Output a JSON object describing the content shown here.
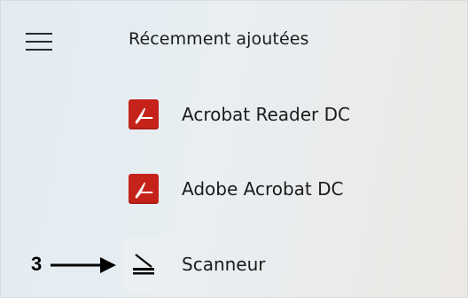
{
  "start_menu": {
    "menu_button_icon": "hamburger-icon",
    "section_title": "Récemment ajoutées",
    "apps": [
      {
        "label": "Acrobat Reader DC",
        "icon": "acrobat-pdf-icon",
        "icon_color": "#c5221a"
      },
      {
        "label": "Adobe Acrobat DC",
        "icon": "acrobat-pdf-icon",
        "icon_color": "#c5221a"
      },
      {
        "label": "Scanneur",
        "icon": "scanner-icon",
        "icon_color": "#000000"
      }
    ]
  },
  "annotation": {
    "number": "3",
    "arrow_icon": "arrow-right-icon"
  }
}
